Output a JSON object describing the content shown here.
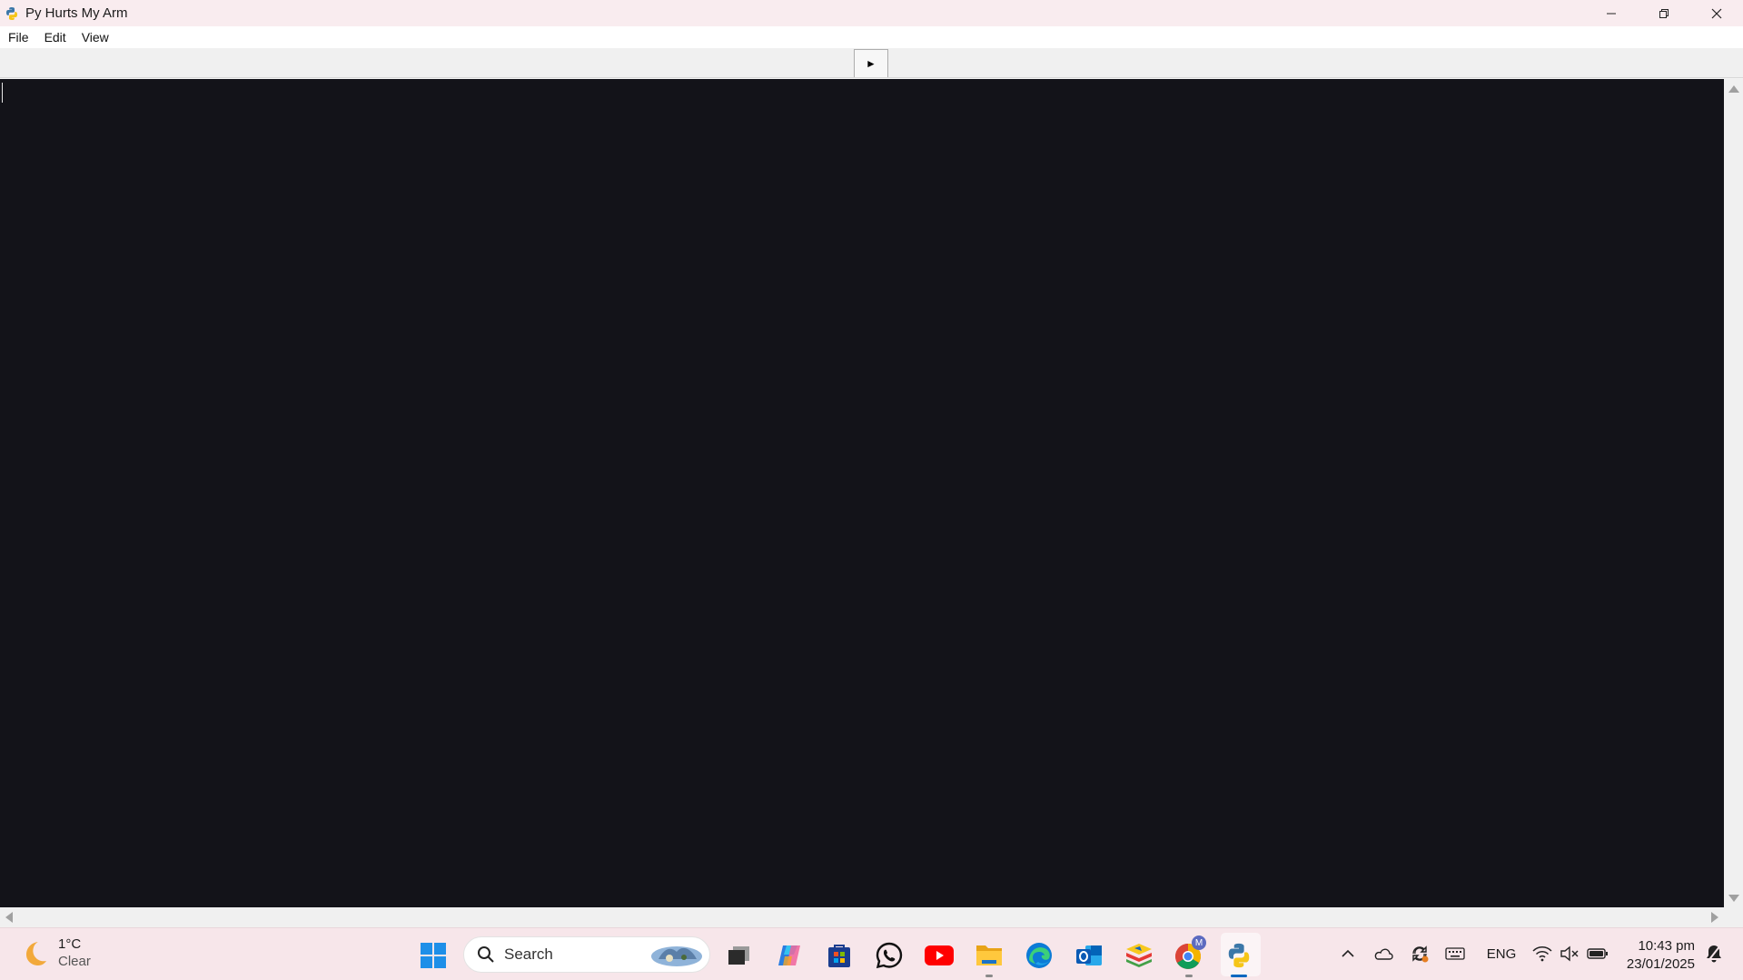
{
  "window": {
    "title": "Py Hurts My Arm",
    "controls": [
      "minimize-icon",
      "restore-icon",
      "close-icon"
    ]
  },
  "menu": {
    "items": [
      "File",
      "Edit",
      "View"
    ]
  },
  "toolbar": {
    "run_label": "►"
  },
  "editor": {
    "background": "#131319",
    "content": ""
  },
  "taskbar": {
    "weather": {
      "temp": "1°C",
      "condition": "Clear",
      "icon": "moon-icon"
    },
    "search": {
      "label": "Search"
    },
    "apps": [
      "windows-start-icon",
      "task-view-icon",
      "copilot-icon",
      "microsoft-store-icon",
      "whatsapp-icon",
      "youtube-icon",
      "file-explorer-icon",
      "edge-icon",
      "outlook-icon",
      "bluestacks-icon",
      "chrome-icon",
      "python-icon"
    ],
    "chrome_badge": "M",
    "tray": {
      "language": "ENG",
      "time": "10:43 pm",
      "date": "23/01/2025"
    }
  }
}
